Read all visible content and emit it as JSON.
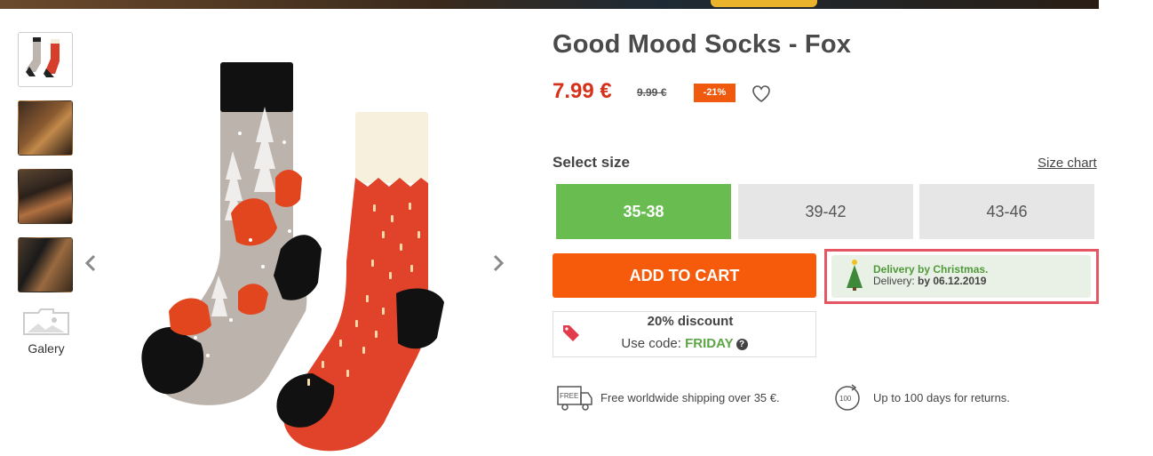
{
  "product": {
    "title": "Good Mood Socks - Fox",
    "price": "7.99 €",
    "old_price": "9.99 €",
    "discount_badge": "-21%"
  },
  "gallery": {
    "label": "Galery",
    "thumbnail_count": 4
  },
  "size": {
    "label": "Select size",
    "chart_link": "Size chart",
    "options": [
      "35-38",
      "39-42",
      "43-46"
    ],
    "selected": "35-38"
  },
  "cart": {
    "button_label": "ADD TO CART"
  },
  "delivery": {
    "line1": "Delivery by Christmas.",
    "line2_prefix": "Delivery:",
    "line2_value": "by 06.12.2019"
  },
  "promo": {
    "title": "20% discount",
    "code_prefix": "Use code:",
    "code": "FRIDAY",
    "help_icon": "?"
  },
  "benefits": {
    "shipping": "Free worldwide shipping over 35 €.",
    "truck_label": "FREE",
    "returns": "Up to 100 days for returns.",
    "returns_badge": "100"
  },
  "colors": {
    "accent_orange": "#f55b0b",
    "price_red": "#d6311b",
    "selected_green": "#69bd50",
    "highlight_border": "#e45664"
  },
  "icons": [
    "chevron-left-icon",
    "chevron-right-icon",
    "heart-icon",
    "tag-icon",
    "help-icon",
    "truck-icon",
    "returns-icon",
    "christmas-tree-icon",
    "image-icon"
  ]
}
